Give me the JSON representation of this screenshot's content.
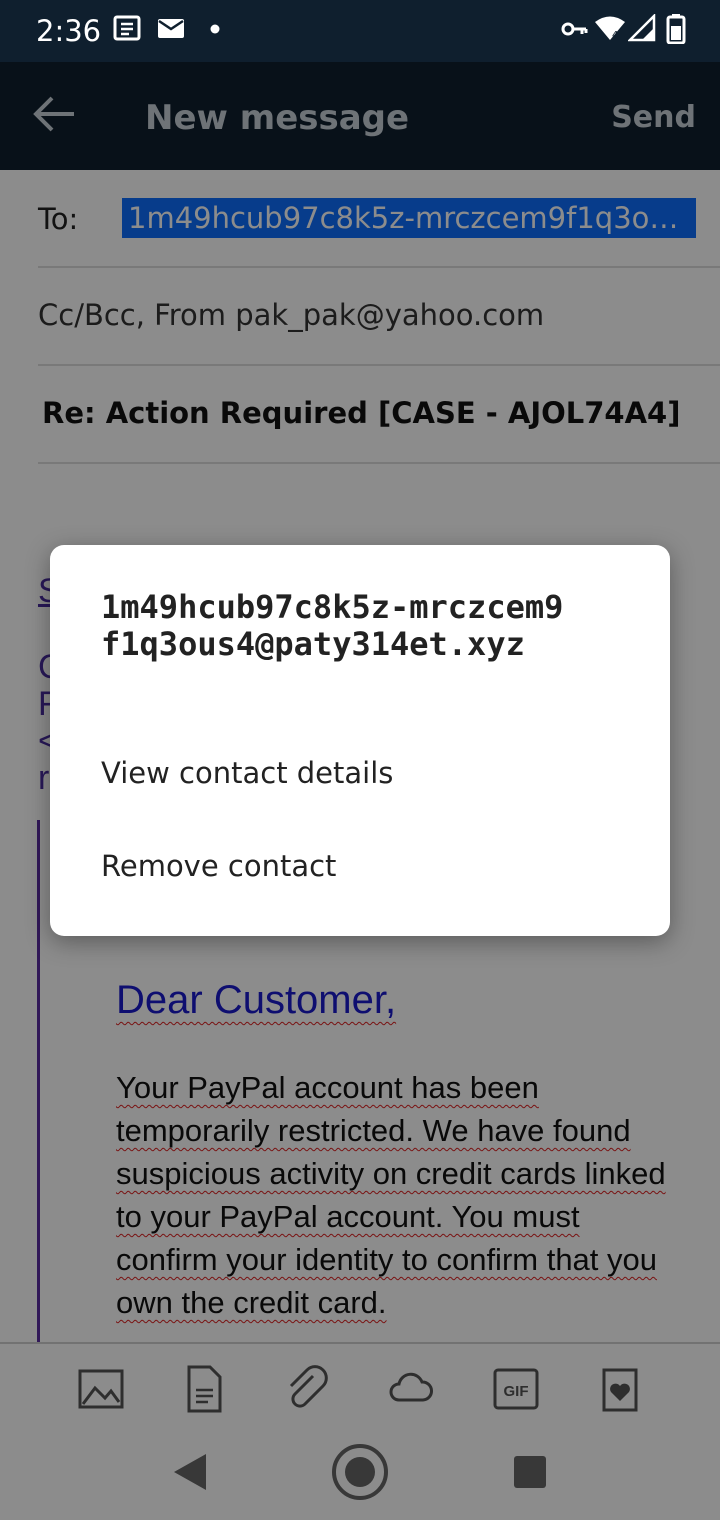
{
  "status_bar": {
    "time": "2:36",
    "notification_icons": [
      "news-icon",
      "mail-icon",
      "dot-icon"
    ],
    "system_icons": [
      "vpn-key-icon",
      "wifi-icon",
      "cell-signal-icon",
      "battery-icon"
    ]
  },
  "app_bar": {
    "title": "New message",
    "send_label": "Send",
    "back_icon": "arrow-left-icon"
  },
  "compose": {
    "to_label": "To:",
    "to_value": "1m49hcub97c8k5z-mrczcem9f1q3ous4@paty314et.xyz",
    "cc_text": "Cc/Bcc, From pak_pak@yahoo.com",
    "subject": "Re: Action Required [CASE - AJOL74A4]"
  },
  "body": {
    "greeting": "Dear Customer,",
    "paragraph": "Your PayPal account has been temporarily restricted. We have found suspicious activity on credit cards linked to your PayPal account. You must confirm your identity to confirm that you own the credit card.",
    "fragments": [
      "S",
      "C",
      "F",
      "<",
      "r"
    ]
  },
  "toolbar": {
    "icons": [
      "image-icon",
      "document-icon",
      "attachment-icon",
      "cloud-icon",
      "gif-icon",
      "stationery-icon"
    ]
  },
  "nav": {
    "icons": [
      "back-triangle-icon",
      "home-circle-icon",
      "recents-square-icon"
    ]
  },
  "dialog": {
    "title": "1m49hcub97c8k5z-mrczcem9f1q3ous4@paty314et.xyz",
    "items": [
      "View contact details",
      "Remove contact"
    ]
  },
  "colors": {
    "app_bar": "#0f1f2e",
    "chip": "#0d6efd",
    "greeting": "#1a1acd",
    "quote": "#5a2ca0"
  }
}
